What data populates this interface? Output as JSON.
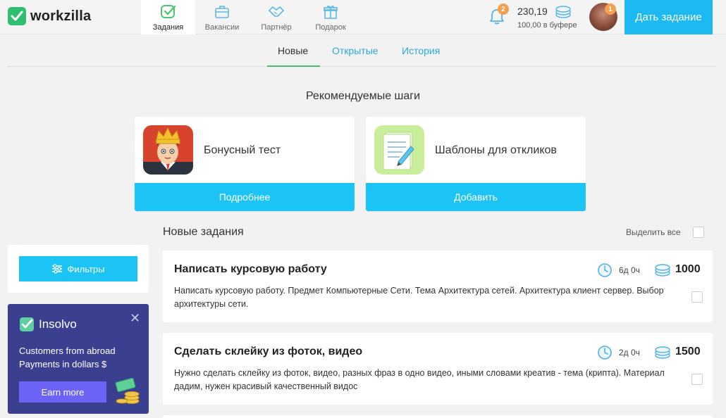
{
  "header": {
    "logo_text": "workzilla",
    "nav": [
      {
        "label": "Задания",
        "icon": "check-square-icon",
        "active": true
      },
      {
        "label": "Вакансии",
        "icon": "briefcase-icon",
        "active": false
      },
      {
        "label": "Партнёр",
        "icon": "handshake-icon",
        "active": false
      },
      {
        "label": "Подарок",
        "icon": "gift-icon",
        "active": false
      }
    ],
    "notifications_count": "2",
    "balance": "230,19",
    "balance_buffer": "100,00 в буфере",
    "avatar_badge": "1",
    "give_task_button": "Дать задание"
  },
  "subtabs": {
    "new": "Новые",
    "open": "Открытые",
    "history": "История"
  },
  "recommended": {
    "title": "Рекомендуемые шаги",
    "cards": [
      {
        "title": "Бонусный тест",
        "button": "Подробнее",
        "icon": "king-character-icon"
      },
      {
        "title": "Шаблоны для откликов",
        "button": "Добавить",
        "icon": "document-pen-icon"
      }
    ]
  },
  "tasks_section": {
    "title": "Новые задания",
    "select_all": "Выделить все"
  },
  "sidebar": {
    "filters_button": "Фильтры",
    "promo": {
      "brand": "Insolvo",
      "text_line1": "Customers from abroad",
      "text_line2": "Payments in dollars $",
      "button": "Earn more",
      "close": "✕"
    }
  },
  "tasks": [
    {
      "title": "Написать курсовую работу",
      "time": "6д 0ч",
      "price": "1000",
      "description": "Написать курсовую работу. Предмет Компьютерные Сети. Тема Архитектура сетей. Архитектура клиент сервер. Выбор архитектуры сети."
    },
    {
      "title": "Сделать склейку из фоток, видео",
      "time": "2д 0ч",
      "price": "1500",
      "description": "Нужно сделать склейку из фоток, видео, разных фраз в одно видео, иными словами креатив - тема (крипта). Материал дадим, нужен красивый качественный видос"
    }
  ],
  "colors": {
    "accent_blue": "#1cc3f5",
    "brand_green": "#2fbf71",
    "link_blue": "#2ea8db",
    "promo_bg": "#3b3f8f",
    "promo_button": "#6c63f7"
  }
}
